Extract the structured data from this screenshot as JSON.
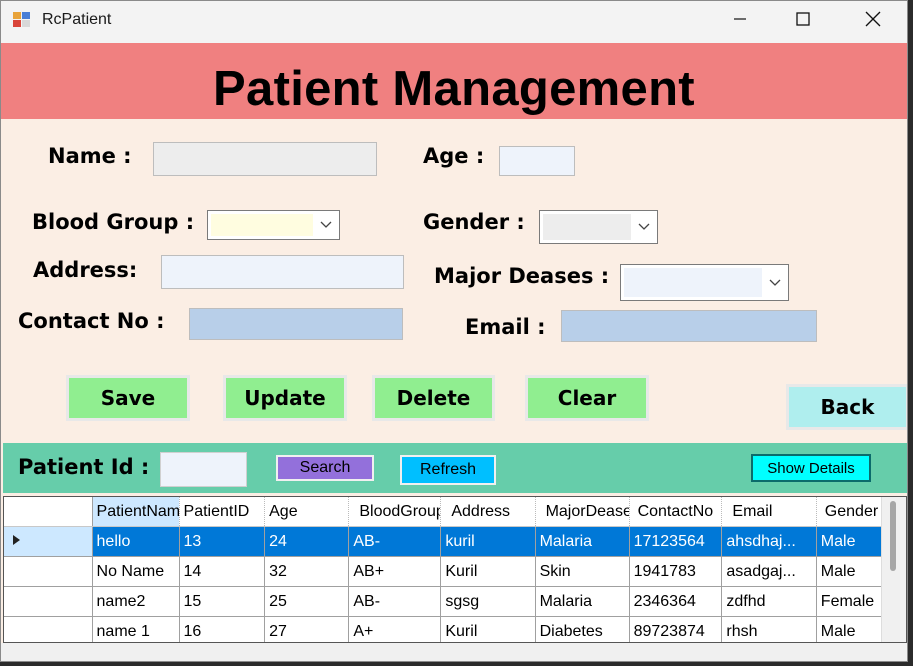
{
  "window": {
    "title": "RcPatient"
  },
  "header": {
    "title": "Patient Management"
  },
  "form": {
    "name_label": "Name :",
    "age_label": "Age :",
    "blood_group_label": "Blood Group :",
    "gender_label": "Gender :",
    "address_label": "Address:",
    "major_diseases_label": "Major Deases :",
    "contact_label": "Contact No :",
    "email_label": "Email :",
    "name_value": "",
    "age_value": "",
    "address_value": "",
    "contact_value": "",
    "email_value": ""
  },
  "buttons": {
    "save": "Save",
    "update": "Update",
    "delete": "Delete",
    "clear": "Clear",
    "back": "Back"
  },
  "search": {
    "patient_id_label": "Patient Id :",
    "patient_id_value": "",
    "search_button": "Search",
    "refresh_button": "Refresh",
    "show_details_button": "Show Details"
  },
  "table": {
    "columns": [
      "PatientName",
      "PatientID",
      "Age",
      "BloodGroup",
      "Address",
      "MajorDeases",
      "ContactNo",
      "Email",
      "Gender"
    ],
    "rows": [
      [
        "hello",
        "13",
        "24",
        "AB-",
        "kuril",
        "Malaria",
        "17123564",
        "ahsdhaj...",
        "Male"
      ],
      [
        "No Name",
        "14",
        "32",
        "AB+",
        "Kuril",
        " Skin",
        "1941783",
        "asadgaj...",
        "Male"
      ],
      [
        "name2",
        "15",
        "25",
        "AB-",
        "sgsg",
        "Malaria",
        "2346364",
        "zdfhd",
        "Female"
      ],
      [
        "name 1",
        "16",
        "27",
        "A+",
        "Kuril",
        "Diabetes",
        "89723874",
        "rhsh",
        "Male"
      ]
    ],
    "selected_row": 0
  },
  "colors": {
    "header_bg": "#f08080",
    "form_bg": "#fbeee4",
    "search_bar_bg": "#66cdaa",
    "button_green": "#90ee90",
    "back_button": "#afeeee",
    "search_button": "#9370db",
    "refresh_button": "#00bfff",
    "show_details_button": "#00ffff",
    "selection": "#0078d7"
  }
}
